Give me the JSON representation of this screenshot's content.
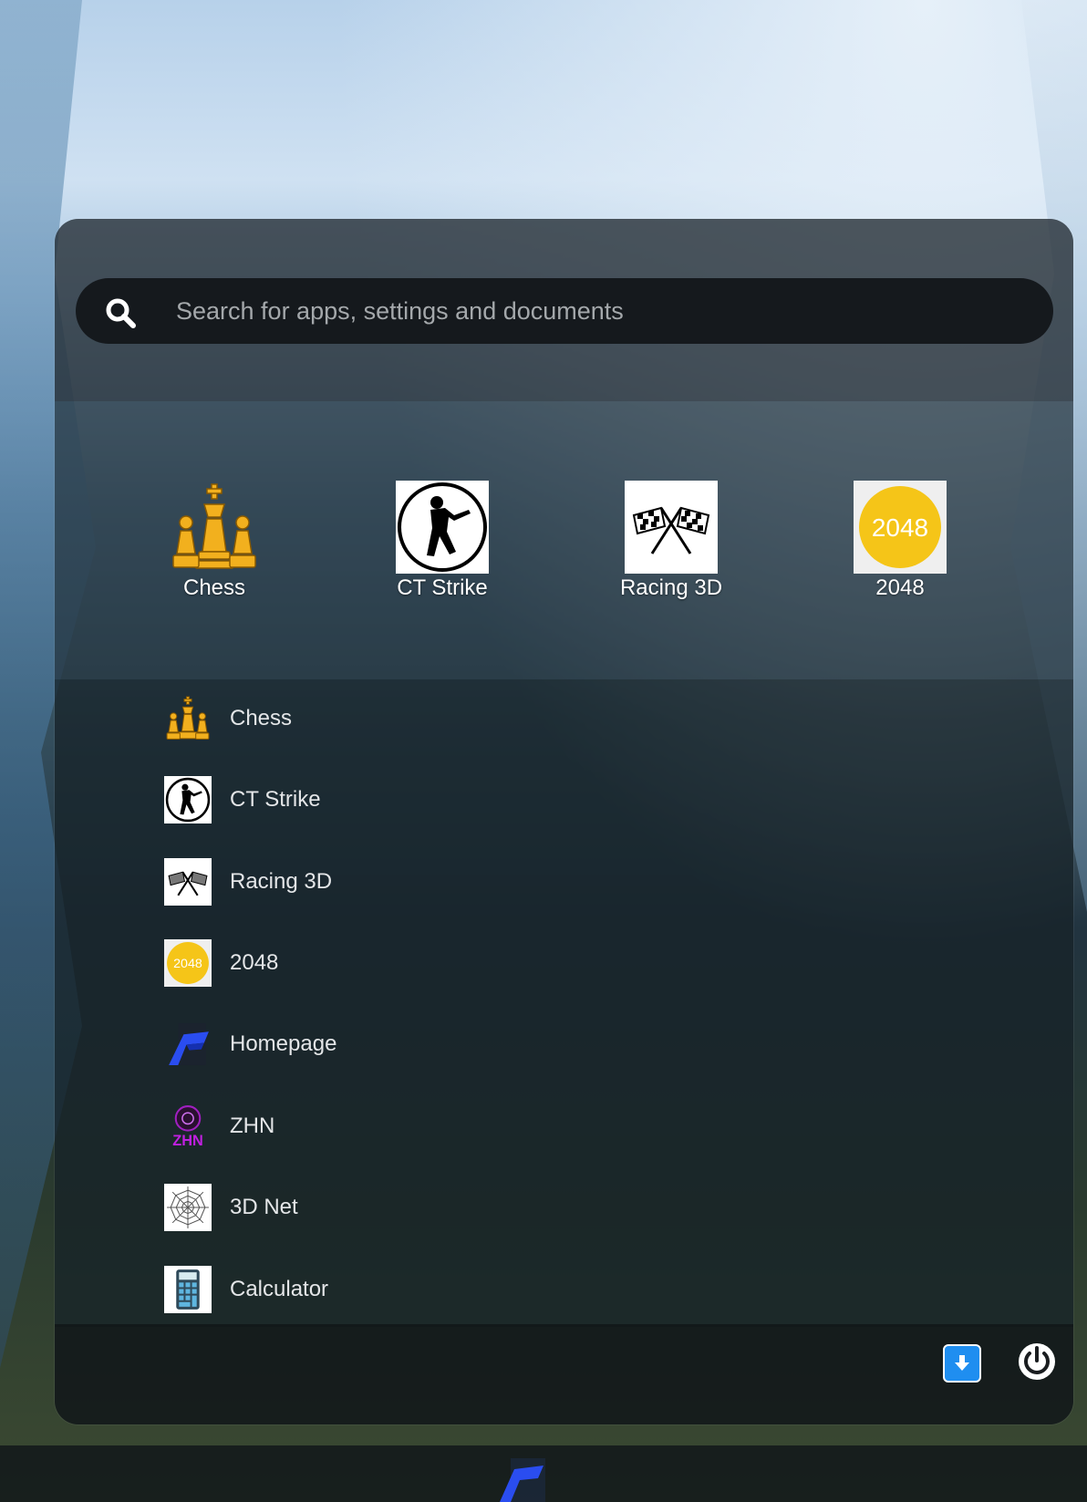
{
  "search": {
    "placeholder": "Search for apps, settings and documents",
    "value": ""
  },
  "pinned": [
    {
      "label": "Chess",
      "icon": "chess-icon"
    },
    {
      "label": "CT Strike",
      "icon": "ct-strike-icon"
    },
    {
      "label": "Racing 3D",
      "icon": "racing-flags-icon"
    },
    {
      "label": "2048",
      "icon": "2048-icon",
      "icon_text": "2048"
    }
  ],
  "apps": [
    {
      "label": "Chess",
      "icon": "chess-icon"
    },
    {
      "label": "CT Strike",
      "icon": "ct-strike-icon"
    },
    {
      "label": "Racing 3D",
      "icon": "racing-flags-icon"
    },
    {
      "label": "2048",
      "icon": "2048-icon",
      "icon_text": "2048"
    },
    {
      "label": "Homepage",
      "icon": "homepage-logo-icon"
    },
    {
      "label": "ZHN",
      "icon": "zhn-logo-icon",
      "icon_text": "ZHN"
    },
    {
      "label": "3D Net",
      "icon": "spider-web-icon"
    },
    {
      "label": "Calculator",
      "icon": "calculator-icon"
    }
  ],
  "footer": {
    "download_icon": "download-icon",
    "power_icon": "power-icon"
  },
  "taskbar": {
    "start_icon": "start-logo-icon"
  },
  "colors": {
    "accent_blue": "#1f8ef0",
    "chess_gold": "#f2b01e",
    "tile_2048": "#f5c518",
    "zhn_purple": "#a020c0"
  }
}
